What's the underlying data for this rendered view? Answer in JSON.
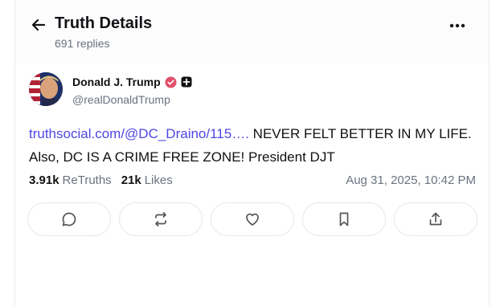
{
  "header": {
    "title": "Truth Details",
    "replies": "691 replies"
  },
  "author": {
    "display_name": "Donald J. Trump",
    "handle": "@realDonaldTrump",
    "verified_color": "#e0506a"
  },
  "post": {
    "link_text": "truthsocial.com/@DC_Draino/115….",
    "body_text": " NEVER FELT BETTER IN MY LIFE. Also, DC IS A CRIME FREE ZONE! President DJT"
  },
  "stats": {
    "retruths_count": "3.91k",
    "retruths_label": "ReTruths",
    "likes_count": "21k",
    "likes_label": "Likes",
    "timestamp": "Aug 31, 2025, 10:42 PM"
  },
  "actions": [
    "reply-icon",
    "retruth-icon",
    "like-icon",
    "bookmark-icon",
    "share-icon"
  ],
  "colors": {
    "link": "#4f46e5",
    "muted": "#6b7280"
  }
}
